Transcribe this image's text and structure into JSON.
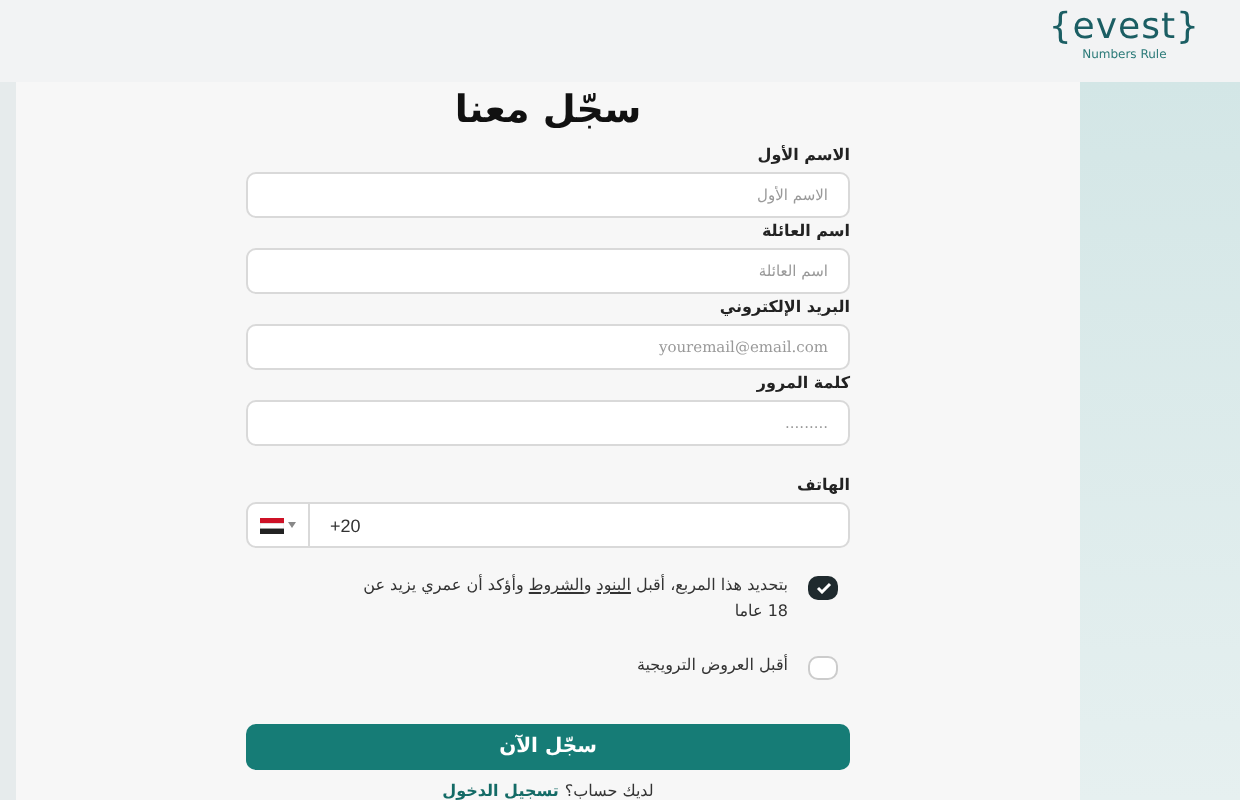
{
  "header": {
    "logo": "{evest}",
    "tagline": "Numbers Rule"
  },
  "form": {
    "title": "سجّل معنا",
    "fields": [
      {
        "label": "الاسم الأول",
        "placeholder": "الاسم الأول",
        "kind": "text"
      },
      {
        "label": "اسم العائلة",
        "placeholder": "اسم العائلة",
        "kind": "text"
      },
      {
        "label": "البريد الإلكتروني",
        "placeholder": "youremail@email.com",
        "kind": "email"
      },
      {
        "label": "كلمة المرور",
        "placeholder": ".........",
        "kind": "password"
      }
    ],
    "phone": {
      "label": "الهاتف",
      "value": "+20"
    },
    "checks": [
      {
        "checked": true,
        "parts": [
          {
            "kind": "text",
            "text": "بتحديد هذا المربع، أقبل "
          },
          {
            "kind": "link",
            "text": "البنود"
          },
          {
            "kind": "text",
            "text": " و"
          },
          {
            "kind": "link",
            "text": "الشروط"
          },
          {
            "kind": "text",
            "text": " وأؤكد أن عمري يزيد عن 18 عاما"
          }
        ]
      },
      {
        "checked": false,
        "parts": [
          {
            "kind": "text",
            "text": "أقبل العروض الترويجية"
          }
        ]
      }
    ],
    "submit": "سجّل الآن",
    "login": {
      "prompt": "لديك حساب؟",
      "link": "تسجيل الدخول"
    }
  }
}
